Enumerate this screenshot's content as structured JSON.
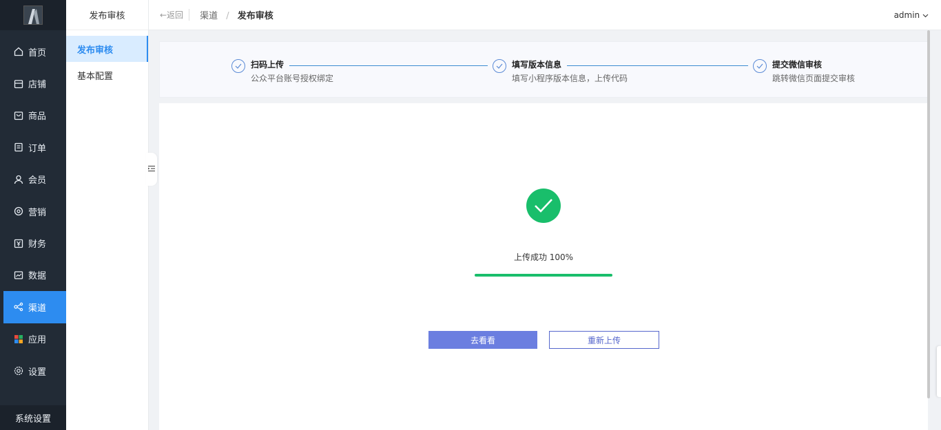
{
  "sidebar": {
    "items": [
      {
        "label": "首页",
        "icon": "home-icon"
      },
      {
        "label": "店铺",
        "icon": "store-icon"
      },
      {
        "label": "商品",
        "icon": "goods-icon"
      },
      {
        "label": "订单",
        "icon": "order-icon"
      },
      {
        "label": "会员",
        "icon": "member-icon"
      },
      {
        "label": "营销",
        "icon": "marketing-icon"
      },
      {
        "label": "财务",
        "icon": "finance-icon"
      },
      {
        "label": "数据",
        "icon": "data-icon"
      },
      {
        "label": "渠道",
        "icon": "channel-icon",
        "active": true
      },
      {
        "label": "应用",
        "icon": "apps-icon"
      },
      {
        "label": "设置",
        "icon": "settings-icon"
      }
    ],
    "footer_label": "系统设置",
    "active_color": "#2d8cf0"
  },
  "submenu": {
    "title": "发布审核",
    "items": [
      {
        "label": "发布审核",
        "active": true
      },
      {
        "label": "基本配置"
      }
    ]
  },
  "header": {
    "back_label": "←返回",
    "breadcrumb": [
      "渠道",
      "/",
      "发布审核"
    ],
    "user": "admin"
  },
  "steps": [
    {
      "title": "扫码上传",
      "desc": "公众平台账号授权绑定"
    },
    {
      "title": "填写版本信息",
      "desc": "填写小程序版本信息，上传代码"
    },
    {
      "title": "提交微信审核",
      "desc": "跳转微信页面提交审核"
    }
  ],
  "upload": {
    "status_text": "上传成功 100%",
    "progress": 1.0,
    "success_color": "#19be6b"
  },
  "actions": {
    "view_label": "去看看",
    "reupload_label": "重新上传"
  }
}
